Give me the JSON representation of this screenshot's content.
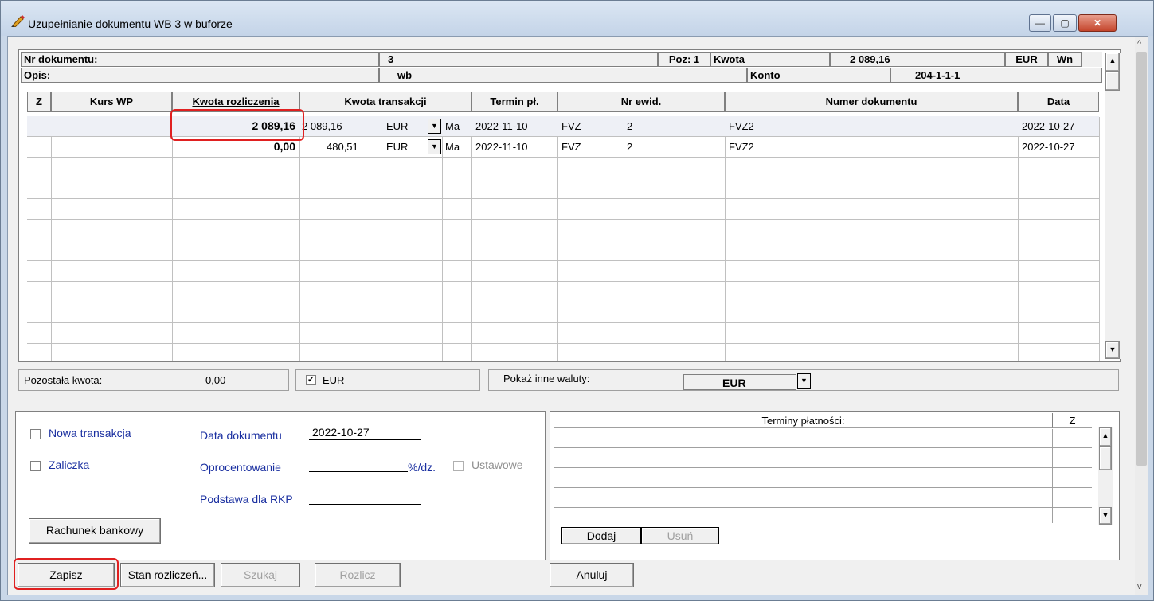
{
  "window": {
    "title": "Uzupełnianie dokumentu WB 3 w buforze"
  },
  "window_controls": {
    "minimize": "—",
    "maximize": "▢",
    "close": "✕"
  },
  "header": {
    "nr_dokumentu_label": "Nr dokumentu:",
    "nr_dokumentu_value": "3",
    "poz": "Poz: 1",
    "kwota_label": "Kwota",
    "kwota_value": "2 089,16",
    "currency": "EUR",
    "side": "Wn",
    "opis_label": "Opis:",
    "opis_value": "wb",
    "konto_label": "Konto",
    "konto_value": "204-1-1-1"
  },
  "columns": [
    "Z",
    "Kurs WP",
    "Kwota rozliczenia",
    "Kwota transakcji",
    "Termin pł.",
    "Nr ewid.",
    "Numer dokumentu",
    "Data"
  ],
  "rows": [
    {
      "kwota_rozliczenia": "2 089,16",
      "kwota_transakcji": "2 089,16",
      "waluta": "EUR",
      "strona": "Ma",
      "termin": "2022-11-10",
      "ewid_typ": "FVZ",
      "ewid_nr": "2",
      "numer_dokumentu": "FVZ2",
      "data": "2022-10-27"
    },
    {
      "kwota_rozliczenia": "0,00",
      "kwota_transakcji": "480,51",
      "waluta": "EUR",
      "strona": "Ma",
      "termin": "2022-11-10",
      "ewid_typ": "FVZ",
      "ewid_nr": "2",
      "numer_dokumentu": "FVZ2",
      "data": "2022-10-27"
    }
  ],
  "status": {
    "pozostala_label": "Pozostała kwota:",
    "pozostala_value": "0,00",
    "eur_checkbox_label": "EUR",
    "eur_checkbox_mark": "✓",
    "pokaz_label": "Pokaż inne waluty:",
    "pokaz_value": "EUR"
  },
  "form": {
    "nowa_transakcja": "Nowa transakcja",
    "zaliczka": "Zaliczka",
    "data_dokumentu_label": "Data dokumentu",
    "data_dokumentu_value": "2022-10-27",
    "oprocentowanie_label": "Oprocentowanie",
    "oprocentowanie_unit": "%/dz.",
    "ustawowe": "Ustawowe",
    "podstawa_label": "Podstawa dla RKP",
    "rachunek_button": "Rachunek bankowy"
  },
  "terminy": {
    "header": "Terminy płatności:",
    "z_col": "Z",
    "dodaj": "Dodaj",
    "usun": "Usuń"
  },
  "buttons": {
    "zapisz": "Zapisz",
    "stan": "Stan rozliczeń...",
    "szukaj": "Szukaj",
    "rozlicz": "Rozlicz",
    "anuluj": "Anuluj"
  },
  "icons": {
    "scroll_up": "▲",
    "scroll_down": "▼",
    "combo_arrow": "▼",
    "scroll_up_chevron": "^",
    "scroll_down_chevron": "v"
  }
}
